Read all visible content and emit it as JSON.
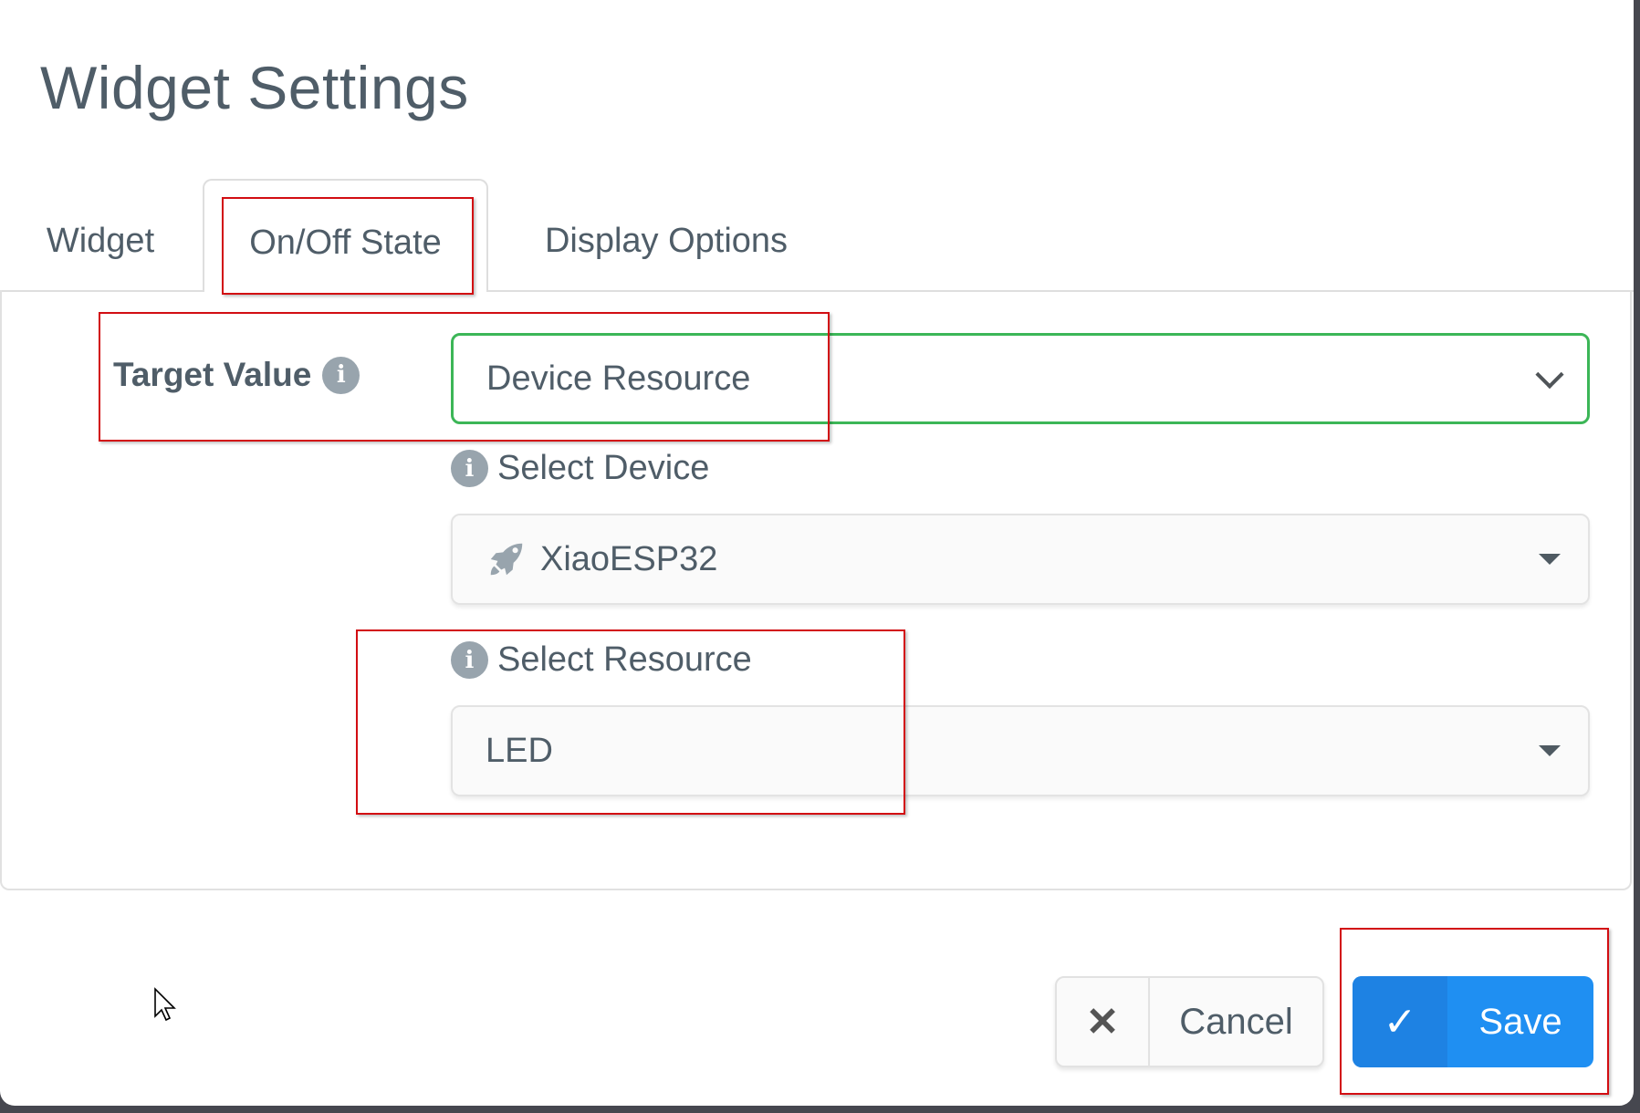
{
  "dialog": {
    "title": "Widget Settings"
  },
  "tabs": [
    {
      "label": "Widget",
      "active": false
    },
    {
      "label": "On/Off State",
      "active": true
    },
    {
      "label": "Display Options",
      "active": false
    }
  ],
  "form": {
    "target_value": {
      "label": "Target Value",
      "info_icon": "info-circle-icon",
      "selected": "Device Resource",
      "dropdown_icon": "chevron-down-icon"
    },
    "select_device": {
      "label": "Select Device",
      "info_icon": "info-circle-icon",
      "item_icon": "rocket-icon",
      "selected": "XiaoESP32",
      "dropdown_icon": "caret-down-icon"
    },
    "select_resource": {
      "label": "Select Resource",
      "info_icon": "info-circle-icon",
      "selected": "LED",
      "dropdown_icon": "caret-down-icon"
    }
  },
  "footer": {
    "cancel": {
      "icon": "close-icon",
      "glyph": "✕",
      "label": "Cancel"
    },
    "save": {
      "icon": "check-icon",
      "glyph": "✓",
      "label": "Save"
    }
  },
  "info_glyph": "i",
  "colors": {
    "primary": "#1f8ff2",
    "success_border": "#3cb657",
    "annotation": "#d20d12",
    "text": "#4f5d68"
  }
}
